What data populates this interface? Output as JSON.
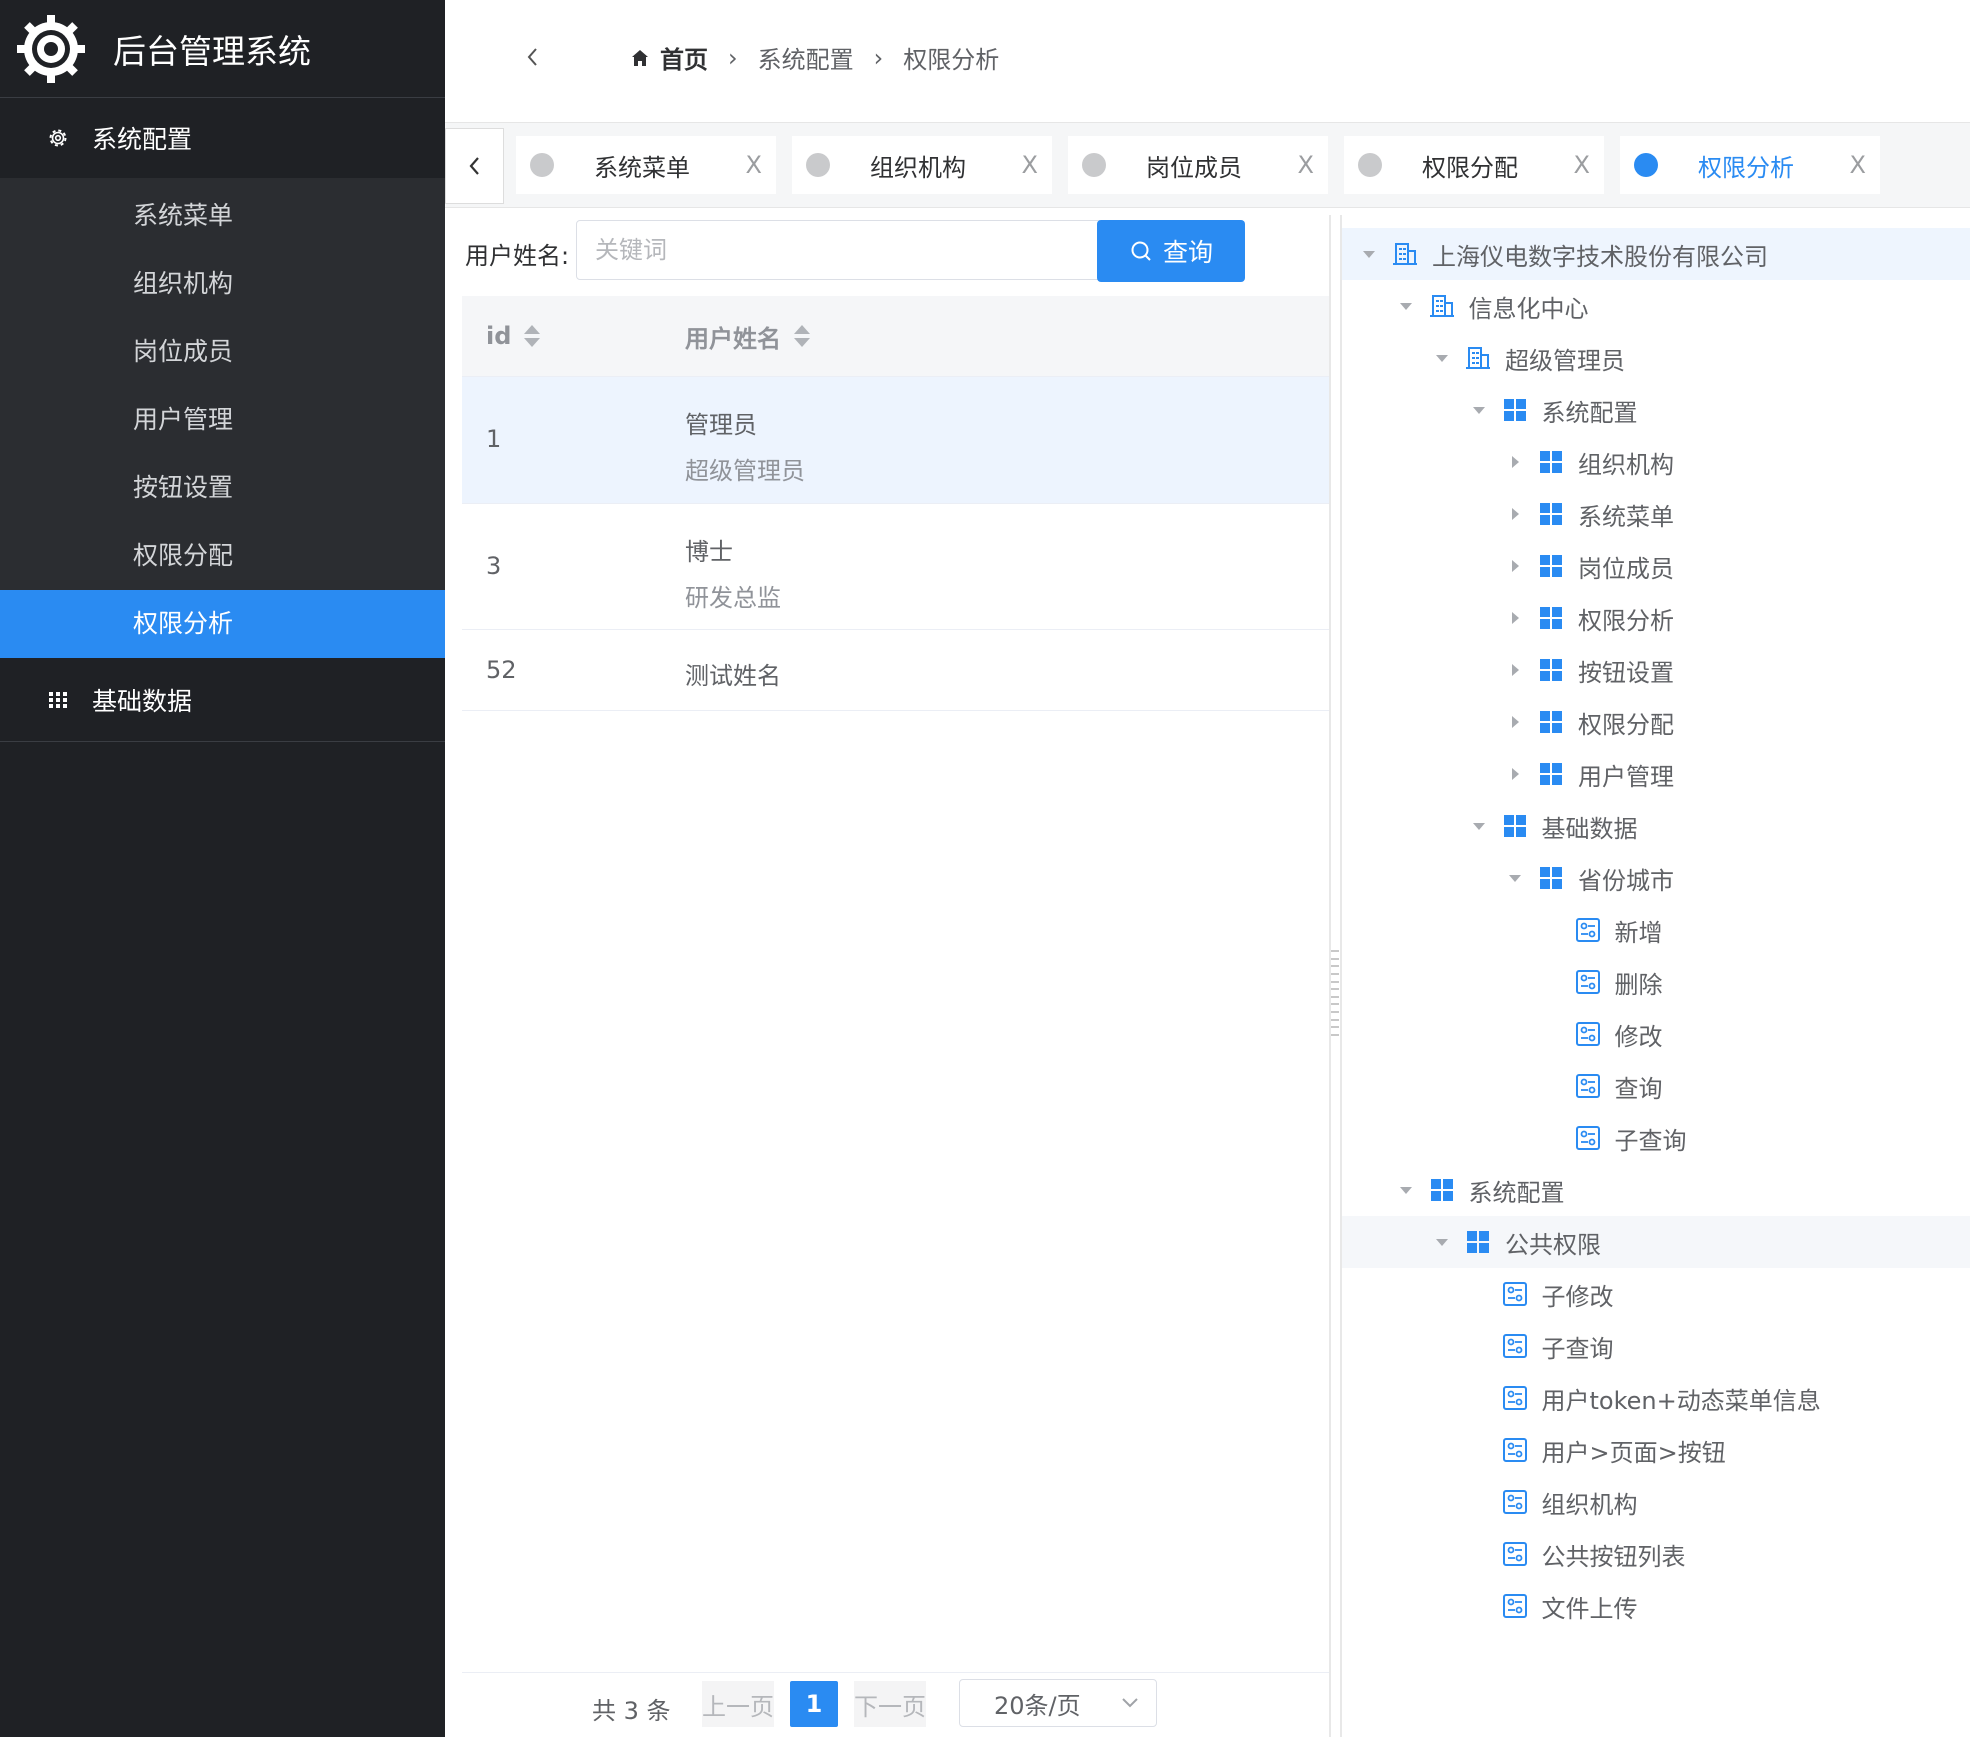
{
  "app": {
    "title": "后台管理系统"
  },
  "sidebar": {
    "group1": {
      "label": "系统配置",
      "icon": "gear-icon"
    },
    "items": [
      {
        "label": "系统菜单"
      },
      {
        "label": "组织机构"
      },
      {
        "label": "岗位成员"
      },
      {
        "label": "用户管理"
      },
      {
        "label": "按钮设置"
      },
      {
        "label": "权限分配"
      },
      {
        "label": "权限分析",
        "active": true
      }
    ],
    "group2": {
      "label": "基础数据",
      "icon": "grid-icon"
    }
  },
  "breadcrumb": {
    "home": "首页",
    "level1": "系统配置",
    "level2": "权限分析"
  },
  "tabs": [
    {
      "label": "系统菜单",
      "close": "X"
    },
    {
      "label": "组织机构",
      "close": "X"
    },
    {
      "label": "岗位成员",
      "close": "X"
    },
    {
      "label": "权限分配",
      "close": "X"
    },
    {
      "label": "权限分析",
      "close": "X",
      "active": true
    }
  ],
  "search": {
    "label": "用户姓名:",
    "placeholder": "关键词",
    "value": "",
    "button": "查询"
  },
  "table": {
    "columns": [
      "id",
      "用户姓名"
    ],
    "rows": [
      {
        "id": "1",
        "name": "管理员",
        "role": "超级管理员"
      },
      {
        "id": "3",
        "name": "博士",
        "role": "研发总监"
      },
      {
        "id": "52",
        "name": "测试姓名",
        "role": ""
      }
    ]
  },
  "pagination": {
    "total": "共 3 条",
    "prev": "上一页",
    "page": "1",
    "next": "下一页",
    "page_size": "20条/页"
  },
  "tree": [
    {
      "label": "上海仪电数字技术股份有限公司",
      "level": 0,
      "icon": "building-icon",
      "expanded": true
    },
    {
      "label": "信息化中心",
      "level": 1,
      "icon": "building-icon",
      "expanded": true
    },
    {
      "label": "超级管理员",
      "level": 2,
      "icon": "building-icon",
      "expanded": true
    },
    {
      "label": "系统配置",
      "level": 3,
      "icon": "grid-icon",
      "expanded": true
    },
    {
      "label": "组织机构",
      "level": 4,
      "icon": "grid-icon",
      "expanded": false
    },
    {
      "label": "系统菜单",
      "level": 4,
      "icon": "grid-icon",
      "expanded": false
    },
    {
      "label": "岗位成员",
      "level": 4,
      "icon": "grid-icon",
      "expanded": false
    },
    {
      "label": "权限分析",
      "level": 4,
      "icon": "grid-icon",
      "expanded": false
    },
    {
      "label": "按钮设置",
      "level": 4,
      "icon": "grid-icon",
      "expanded": false
    },
    {
      "label": "权限分配",
      "level": 4,
      "icon": "grid-icon",
      "expanded": false
    },
    {
      "label": "用户管理",
      "level": 4,
      "icon": "grid-icon",
      "expanded": false
    },
    {
      "label": "基础数据",
      "level": 3,
      "icon": "grid-icon",
      "expanded": true
    },
    {
      "label": "省份城市",
      "level": 4,
      "icon": "grid-icon",
      "expanded": true
    },
    {
      "label": "新增",
      "level": 5,
      "icon": "button-icon"
    },
    {
      "label": "删除",
      "level": 5,
      "icon": "button-icon"
    },
    {
      "label": "修改",
      "level": 5,
      "icon": "button-icon"
    },
    {
      "label": "查询",
      "level": 5,
      "icon": "button-icon"
    },
    {
      "label": "子查询",
      "level": 5,
      "icon": "button-icon"
    },
    {
      "label": "系统配置",
      "level": 1,
      "icon": "grid-icon",
      "expanded": true
    },
    {
      "label": "公共权限",
      "level": 2,
      "icon": "grid-icon",
      "expanded": true
    },
    {
      "label": "子修改",
      "level": 3,
      "icon": "button-icon"
    },
    {
      "label": "子查询",
      "level": 3,
      "icon": "button-icon"
    },
    {
      "label": "用户token+动态菜单信息",
      "level": 3,
      "icon": "button-icon"
    },
    {
      "label": "用户>页面>按钮",
      "level": 3,
      "icon": "button-icon"
    },
    {
      "label": "组织机构",
      "level": 3,
      "icon": "button-icon"
    },
    {
      "label": "公共按钮列表",
      "level": 3,
      "icon": "button-icon"
    },
    {
      "label": "文件上传",
      "level": 3,
      "icon": "button-icon"
    }
  ],
  "colors": {
    "accent": "#2a8bf2",
    "sidebar_bg": "#1f2125",
    "submenu_bg": "#2b2d31"
  }
}
